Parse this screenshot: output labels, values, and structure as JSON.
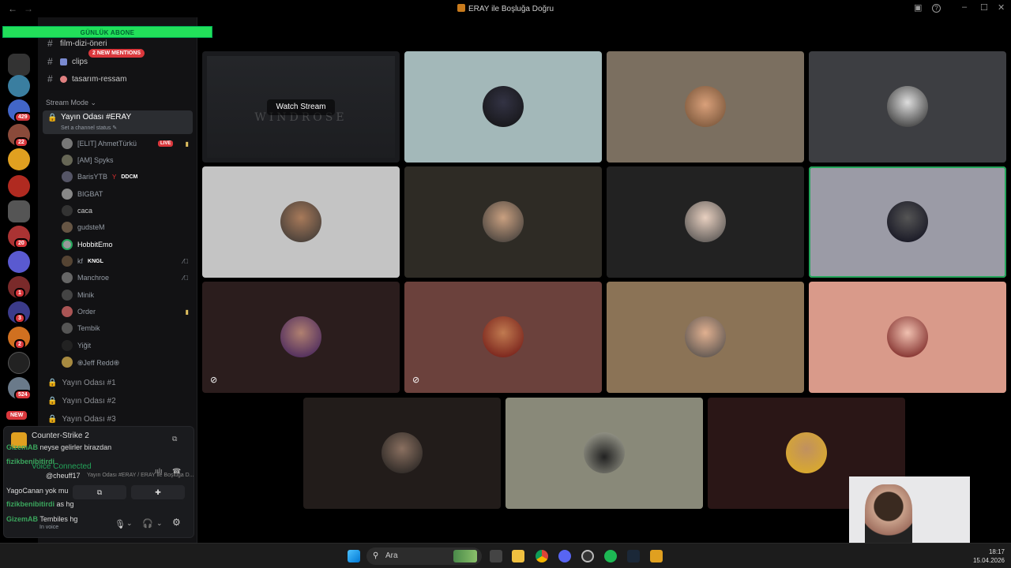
{
  "window": {
    "title": "ERAY ile Boşluğa Doğru"
  },
  "overlay_banner": "GÜNLÜK ABONE",
  "servers": {
    "badges": [
      "429",
      "22",
      "20",
      "1",
      "3",
      "2",
      "524"
    ],
    "new_label": "NEW"
  },
  "channels": {
    "items": [
      {
        "label": "film-dizi-öneri",
        "emoji": ""
      },
      {
        "label": "clips",
        "emoji": ""
      },
      {
        "label": "tasarım-ressam",
        "emoji": ""
      }
    ],
    "mentions_badge": "2 NEW MENTIONS",
    "stream_mode": "Stream Mode"
  },
  "voice_channel": {
    "name": "Yayın Odası #ERAY",
    "status": "Set a channel status",
    "members": [
      {
        "name": "[ELIT] AhmetTürkü",
        "live": "LIVE",
        "tag": ""
      },
      {
        "name": "[AM] Spyks",
        "live": "",
        "tag": ""
      },
      {
        "name": "BarisYTB",
        "live": "",
        "tag": "DDCM"
      },
      {
        "name": "BIGBAT",
        "live": "",
        "tag": ""
      },
      {
        "name": "caca",
        "live": "",
        "tag": ""
      },
      {
        "name": "gudsteM",
        "live": "",
        "tag": ""
      },
      {
        "name": "HobbitEmo",
        "live": "",
        "tag": ""
      },
      {
        "name": "kf",
        "live": "",
        "tag": "KNGL"
      },
      {
        "name": "Manchroe",
        "live": "",
        "tag": ""
      },
      {
        "name": "Minik",
        "live": "",
        "tag": ""
      },
      {
        "name": "Order",
        "live": "",
        "tag": ""
      },
      {
        "name": "Tembik",
        "live": "",
        "tag": ""
      },
      {
        "name": "Yiğit",
        "live": "",
        "tag": ""
      },
      {
        "name": "֎Jeff Redd֎",
        "live": "",
        "tag": ""
      }
    ]
  },
  "rooms": [
    "Yayın Odası #1",
    "Yayın Odası #2",
    "Yayın Odası #3"
  ],
  "activity": {
    "game": "Counter-Strike 2",
    "voice_connected": "Voice Connected",
    "voice_location": "Yayın Odası #ERAY / ERAY ile Boşluğa D...",
    "in_voice": "In voice"
  },
  "chat_overlay": [
    {
      "user": "GizemAB",
      "text": "neyse gelirler birazdan"
    },
    {
      "user": "fizikbenibitirdi",
      "text": ""
    },
    {
      "user": "",
      "text": "@cheuff17"
    },
    {
      "user": "YagoCanan",
      "text": "yok mu"
    },
    {
      "user": "fizikbenibitirdi",
      "text": "as hg"
    },
    {
      "user": "GizemAB",
      "text": "Tembiles hg"
    }
  ],
  "stream": {
    "watch_label": "Watch Stream",
    "preview_title": "WINDROSE"
  },
  "taskbar": {
    "search_placeholder": "Ara",
    "time": "18:17",
    "date": "15.04.2026"
  }
}
